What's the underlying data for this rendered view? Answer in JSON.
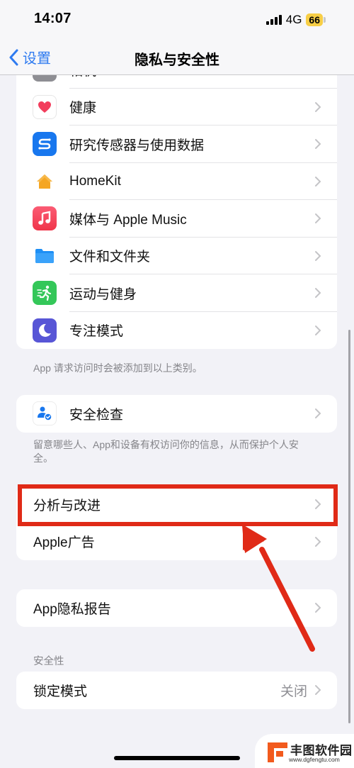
{
  "status_bar": {
    "time": "14:07",
    "network": "4G",
    "battery": "66"
  },
  "nav": {
    "back_label": "设置",
    "title": "隐私与安全性"
  },
  "app_group": {
    "partial_item": "相机",
    "items": [
      {
        "label": "健康",
        "icon": "heart-icon"
      },
      {
        "label": "研究传感器与使用数据",
        "icon": "research-sensor-icon"
      },
      {
        "label": "HomeKit",
        "icon": "home-icon"
      },
      {
        "label": "媒体与 Apple Music",
        "icon": "music-icon"
      },
      {
        "label": "文件和文件夹",
        "icon": "folder-icon"
      },
      {
        "label": "运动与健身",
        "icon": "fitness-runner-icon"
      },
      {
        "label": "专注模式",
        "icon": "moon-icon"
      }
    ],
    "footer": "App 请求访问时会被添加到以上类别。"
  },
  "safety_group": {
    "items": [
      {
        "label": "安全检查",
        "icon": "safety-check-icon"
      }
    ],
    "footer": "留意哪些人、App和设备有权访问你的信息，从而保护个人安全。"
  },
  "analytics_group": {
    "items": [
      {
        "label": "分析与改进"
      },
      {
        "label": "Apple广告"
      }
    ]
  },
  "report_group": {
    "items": [
      {
        "label": "App隐私报告"
      }
    ]
  },
  "security_section": {
    "header": "安全性",
    "items": [
      {
        "label": "锁定模式",
        "value": "关闭"
      }
    ]
  },
  "annotation": {
    "highlight_color": "#e02a17",
    "highlighted_item": "分析与改进"
  },
  "watermark": {
    "title": "丰图软件园",
    "url": "www.dgfengtu.com",
    "color": "#f25a1d"
  },
  "colors": {
    "accent": "#2f7bf0",
    "background": "#f2f2f7"
  }
}
